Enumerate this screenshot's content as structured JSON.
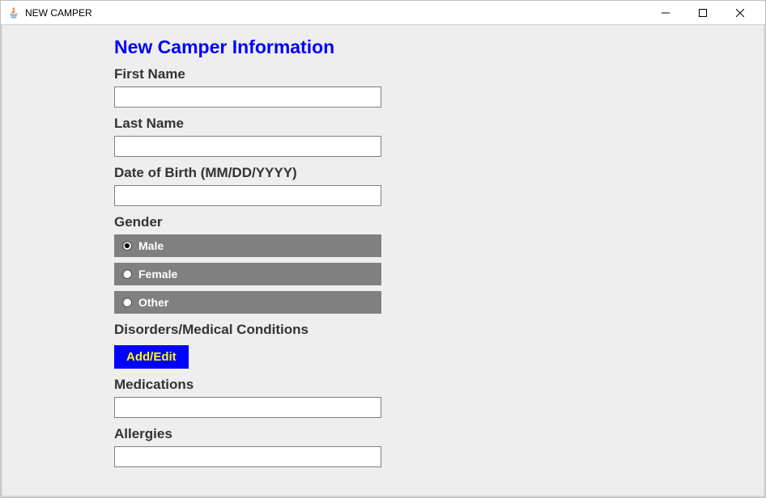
{
  "window": {
    "title": "NEW CAMPER"
  },
  "form": {
    "title": "New Camper Information",
    "firstName": {
      "label": "First Name",
      "value": ""
    },
    "lastName": {
      "label": "Last Name",
      "value": ""
    },
    "dateOfBirth": {
      "label": "Date of Birth (MM/DD/YYYY)",
      "value": ""
    },
    "gender": {
      "label": "Gender",
      "options": {
        "male": "Male",
        "female": "Female",
        "other": "Other"
      },
      "selected": "male"
    },
    "disorders": {
      "label": "Disorders/Medical Conditions",
      "buttonLabel": "Add/Edit"
    },
    "medications": {
      "label": "Medications",
      "value": ""
    },
    "allergies": {
      "label": "Allergies",
      "value": ""
    }
  }
}
